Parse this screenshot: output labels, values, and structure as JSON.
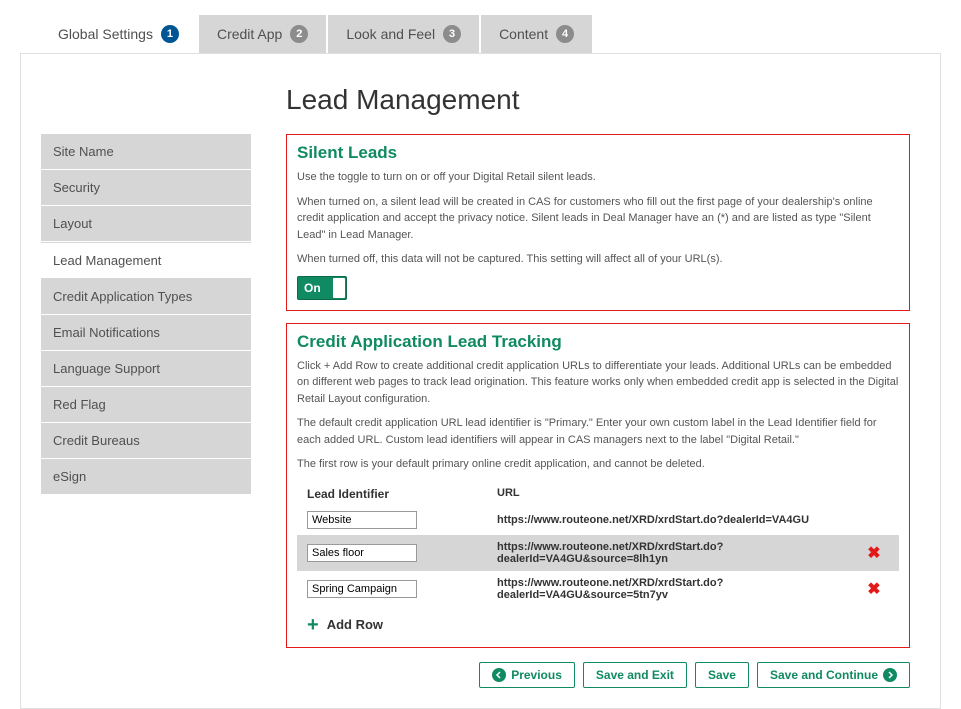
{
  "tabs": [
    {
      "label": "Global Settings",
      "num": "1",
      "active": true
    },
    {
      "label": "Credit App",
      "num": "2",
      "active": false
    },
    {
      "label": "Look and Feel",
      "num": "3",
      "active": false
    },
    {
      "label": "Content",
      "num": "4",
      "active": false
    }
  ],
  "sidebar": [
    {
      "label": "Site Name",
      "active": false
    },
    {
      "label": "Security",
      "active": false
    },
    {
      "label": "Layout",
      "active": false
    },
    {
      "label": "Lead Management",
      "active": true
    },
    {
      "label": "Credit Application Types",
      "active": false
    },
    {
      "label": "Email Notifications",
      "active": false
    },
    {
      "label": "Language Support",
      "active": false
    },
    {
      "label": "Red Flag",
      "active": false
    },
    {
      "label": "Credit Bureaus",
      "active": false
    },
    {
      "label": "eSign",
      "active": false
    }
  ],
  "page_title": "Lead Management",
  "silent_leads": {
    "title": "Silent Leads",
    "p1": "Use the toggle to turn on or off your Digital Retail silent leads.",
    "p2": "When turned on, a silent lead will be created in CAS for customers who fill out the first page of your dealership's online credit application and accept the privacy notice. Silent leads in Deal Manager have an (*) and are listed as type \"Silent Lead\" in Lead Manager.",
    "p3": "When turned off, this data will not be captured. This setting will affect all of your URL(s).",
    "toggle_label": "On"
  },
  "tracking": {
    "title": "Credit Application Lead Tracking",
    "p1": "Click + Add Row to create additional credit application URLs to differentiate your leads. Additional URLs can be embedded on different web pages to track lead origination. This feature works only when embedded credit app is selected in the Digital Retail Layout configuration.",
    "p2": "The default credit application URL lead identifier is \"Primary.\" Enter your own custom label in the Lead Identifier field for each added URL. Custom lead identifiers will appear in CAS managers next to the label \"Digital Retail.\"",
    "p3": "The first row is your default primary online credit application, and cannot be deleted.",
    "header_identifier": "Lead Identifier",
    "header_url": "URL",
    "rows": [
      {
        "identifier": "Website",
        "url": "https://www.routeone.net/XRD/xrdStart.do?dealerId=VA4GU",
        "deletable": false,
        "alt": false
      },
      {
        "identifier": "Sales floor",
        "url": "https://www.routeone.net/XRD/xrdStart.do?dealerId=VA4GU&source=8lh1yn",
        "deletable": true,
        "alt": true
      },
      {
        "identifier": "Spring Campaign",
        "url": "https://www.routeone.net/XRD/xrdStart.do?dealerId=VA4GU&source=5tn7yv",
        "deletable": true,
        "alt": false
      }
    ],
    "add_row_label": "Add Row"
  },
  "buttons": {
    "previous": "Previous",
    "save_exit": "Save and Exit",
    "save": "Save",
    "save_continue": "Save and Continue"
  }
}
